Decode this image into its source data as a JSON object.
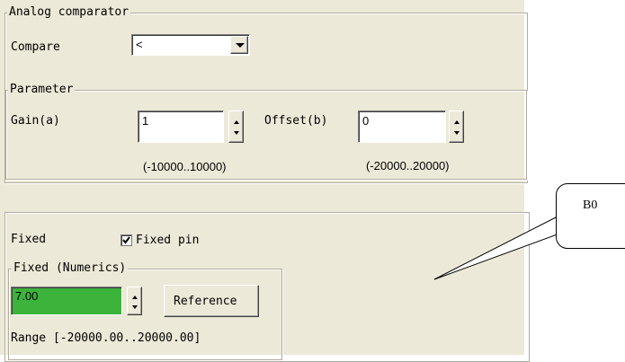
{
  "analog_group": {
    "title": "Analog comparator",
    "compare_label": "Compare",
    "compare_value": "<"
  },
  "parameter_group": {
    "title": "Parameter",
    "gain_label": "Gain(a)",
    "gain_value": "1",
    "gain_range": "(-10000..10000)",
    "offset_label": "Offset(b)",
    "offset_value": "0",
    "offset_range": "(-20000..20000)"
  },
  "fixed_section": {
    "fixed_label": "Fixed",
    "fixed_pin_label": "Fixed pin",
    "fixed_pin_checked": true,
    "numerics_title": "Fixed (Numerics)",
    "numeric_value": "7.00",
    "reference_button": "Reference",
    "range_text": "Range  [-20000.00..20000.00]"
  },
  "callout": {
    "text": "B0"
  },
  "colors": {
    "panel_bg": "#ece9d8",
    "numeric_field_bg": "#3cb43c"
  }
}
